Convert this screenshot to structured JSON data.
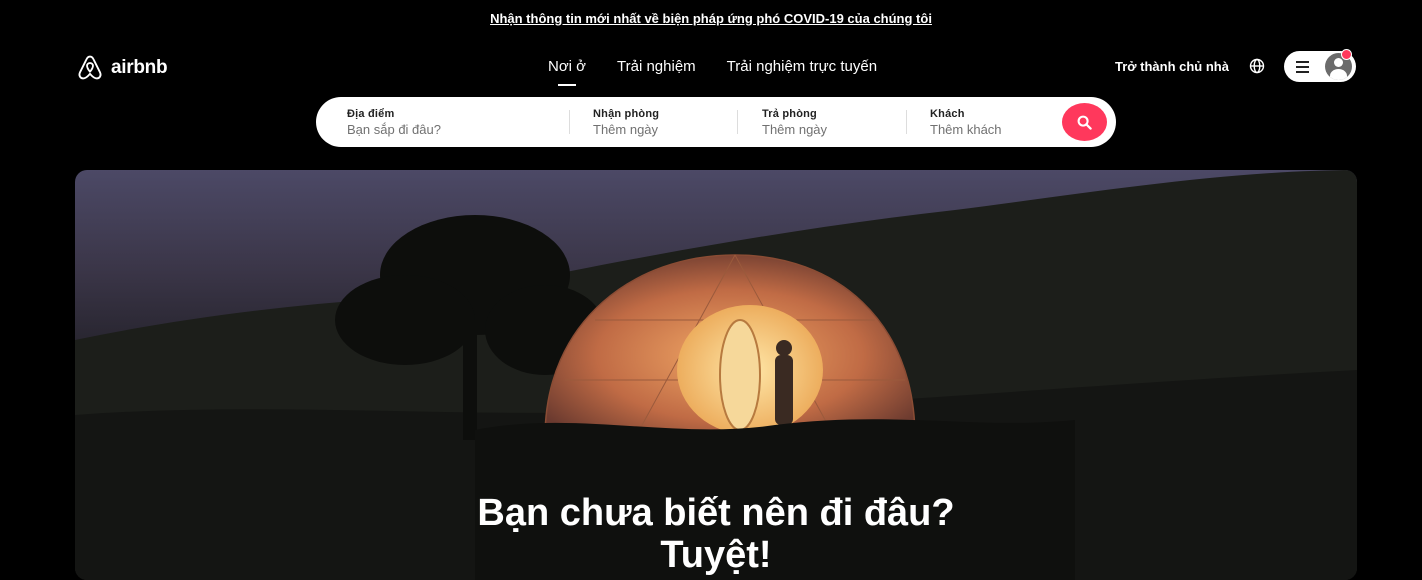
{
  "banner": {
    "covid_link": "Nhận thông tin mới nhất về biện pháp ứng phó COVID-19 của chúng tôi"
  },
  "header": {
    "logo_text": "airbnb",
    "nav": [
      {
        "label": "Nơi ở",
        "active": true
      },
      {
        "label": "Trải nghiệm",
        "active": false
      },
      {
        "label": "Trải nghiệm trực tuyến",
        "active": false
      }
    ],
    "host_link": "Trở thành chủ nhà",
    "globe_icon": "globe-icon",
    "menu_icon": "hamburger-menu-icon",
    "avatar_icon": "user-avatar-icon"
  },
  "search": {
    "location": {
      "label": "Địa điểm",
      "placeholder": "Bạn sắp đi đâu?"
    },
    "checkin": {
      "label": "Nhận phòng",
      "placeholder": "Thêm ngày"
    },
    "checkout": {
      "label": "Trả phòng",
      "placeholder": "Thêm ngày"
    },
    "guests": {
      "label": "Khách",
      "placeholder": "Thêm khách"
    },
    "button_icon": "search-icon"
  },
  "hero": {
    "title_line1": "Bạn chưa biết nên đi đâu?",
    "title_line2": "Tuyệt!"
  },
  "colors": {
    "accent": "#ff385c",
    "background": "#000000"
  }
}
